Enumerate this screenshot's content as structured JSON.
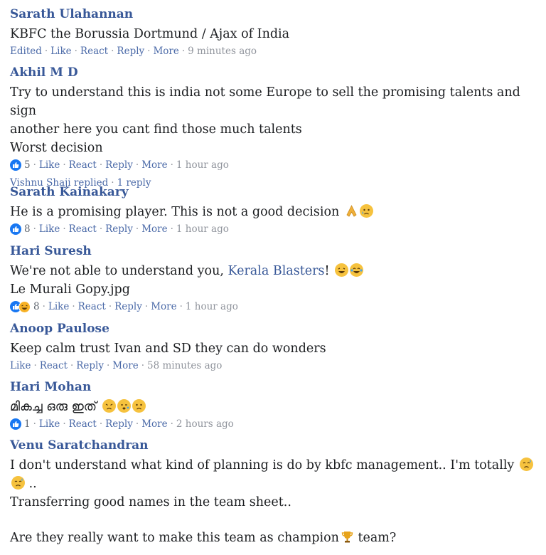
{
  "comments": [
    {
      "author": "Sarath Ulahannan",
      "text": "KBFC the Borussia Dortmund / Ajax of India",
      "edited": "Edited",
      "like": "Like",
      "react": "React",
      "reply": "Reply",
      "more": "More",
      "time": "9 minutes ago"
    },
    {
      "author": "Akhil M D",
      "line1": "Try to understand this is india not some Europe to sell the promising talents and sign",
      "line2": "another here you cant find those much talents",
      "line3": "Worst decision",
      "count": "5",
      "like": "Like",
      "react": "React",
      "reply": "Reply",
      "more": "More",
      "time": "1 hour ago",
      "replied_by": "Vishnu Shaji replied",
      "replies": "1 reply"
    },
    {
      "author": "Sarath Kainakary",
      "text": "He is a promising player. This is not a good decision",
      "count": "8",
      "like": "Like",
      "react": "React",
      "reply": "Reply",
      "more": "More",
      "time": "1 hour ago"
    },
    {
      "author": "Hari Suresh",
      "text_before": "We're not able to understand you,",
      "mention": "Kerala Blasters",
      "text_after": "!",
      "line2": "Le Murali Gopy.jpg",
      "count": "8",
      "like": "Like",
      "react": "React",
      "reply": "Reply",
      "more": "More",
      "time": "1 hour ago"
    },
    {
      "author": "Anoop Paulose",
      "text": "Keep calm trust Ivan and SD they can do wonders",
      "like": "Like",
      "react": "React",
      "reply": "Reply",
      "more": "More",
      "time": "58 minutes ago"
    },
    {
      "author": "Hari Mohan",
      "text": "മികച്ച ഒരു ഇത്",
      "count": "1",
      "like": "Like",
      "react": "React",
      "reply": "Reply",
      "more": "More",
      "time": "2 hours ago"
    },
    {
      "author": "Venu Saratchandran",
      "line1": "I don't understand what kind of planning is do by kbfc management.. I'm totally",
      "line1_end": "..",
      "line2": "Transferring good names in the team sheet..",
      "line3_before": "Are they really want to make this team as champion",
      "line3_after": " team?"
    }
  ],
  "colors": {
    "author": "#385898",
    "meta": "#4b6aa8",
    "time": "#90949c",
    "like": "#1877f2"
  }
}
